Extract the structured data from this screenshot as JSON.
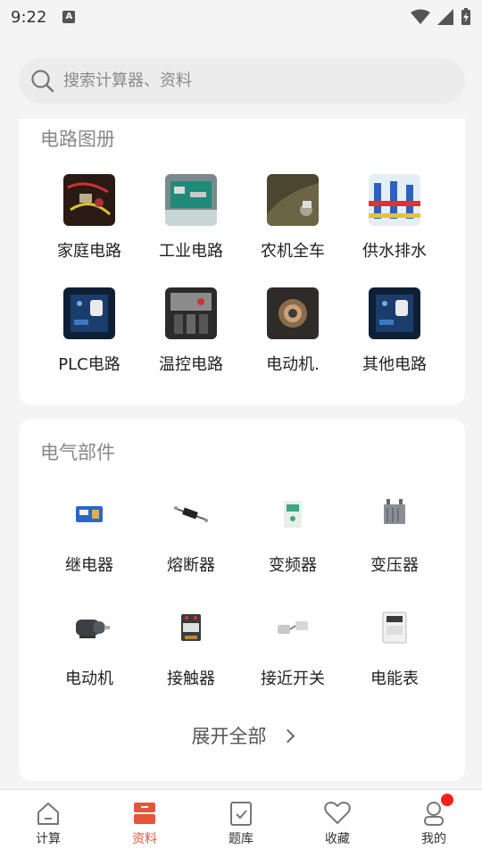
{
  "status": {
    "time": "9:22",
    "a_icon": "A"
  },
  "search": {
    "placeholder": "搜索计算器、资料"
  },
  "circuits": {
    "title": "电路图册",
    "items": [
      {
        "label": "家庭电路",
        "icon": "home-circuit-thumb"
      },
      {
        "label": "工业电路",
        "icon": "industrial-circuit-thumb"
      },
      {
        "label": "农机全车",
        "icon": "farm-machine-thumb"
      },
      {
        "label": "供水排水",
        "icon": "water-supply-thumb"
      },
      {
        "label": "PLC电路",
        "icon": "plc-circuit-thumb"
      },
      {
        "label": "温控电路",
        "icon": "temp-control-thumb"
      },
      {
        "label": "电动机.",
        "icon": "motor-circuit-thumb"
      },
      {
        "label": "其他电路",
        "icon": "other-circuit-thumb"
      }
    ]
  },
  "parts": {
    "title": "电气部件",
    "items": [
      {
        "label": "继电器",
        "icon": "relay-thumb"
      },
      {
        "label": "熔断器",
        "icon": "fuse-thumb"
      },
      {
        "label": "变频器",
        "icon": "inverter-thumb"
      },
      {
        "label": "变压器",
        "icon": "transformer-thumb"
      },
      {
        "label": "电动机",
        "icon": "motor-thumb"
      },
      {
        "label": "接触器",
        "icon": "contactor-thumb"
      },
      {
        "label": "接近开关",
        "icon": "proximity-switch-thumb"
      },
      {
        "label": "电能表",
        "icon": "energy-meter-thumb"
      }
    ],
    "expand_label": "展开全部"
  },
  "tabs": [
    {
      "label": "计算",
      "icon": "home-icon"
    },
    {
      "label": "资料",
      "icon": "materials-icon",
      "active": true
    },
    {
      "label": "题库",
      "icon": "quiz-icon"
    },
    {
      "label": "收藏",
      "icon": "heart-icon"
    },
    {
      "label": "我的",
      "icon": "profile-icon"
    }
  ],
  "colors": {
    "accent": "#e4553a",
    "badge": "#ff1e1e"
  }
}
